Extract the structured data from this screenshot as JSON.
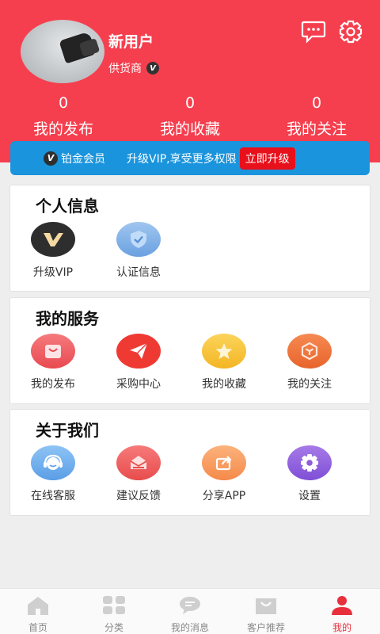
{
  "profile": {
    "name": "新用户",
    "role": "供货商",
    "badge": "V"
  },
  "header_icons": {
    "message": "message-icon",
    "settings": "gear-icon"
  },
  "stats": [
    {
      "count": "0",
      "label": "我的发布"
    },
    {
      "count": "0",
      "label": "我的收藏"
    },
    {
      "count": "0",
      "label": "我的关注"
    }
  ],
  "vip": {
    "badge": "V",
    "level": "铂金会员",
    "desc": "升级VIP,享受更多权限",
    "button": "立即升级"
  },
  "personal": {
    "title": "个人信息",
    "items": [
      {
        "label": "升级VIP",
        "icon": "vip-icon"
      },
      {
        "label": "认证信息",
        "icon": "shield-check-icon"
      }
    ]
  },
  "services": {
    "title": "我的服务",
    "items": [
      {
        "label": "我的发布",
        "icon": "bag-icon"
      },
      {
        "label": "采购中心",
        "icon": "paper-plane-icon"
      },
      {
        "label": "我的收藏",
        "icon": "star-icon"
      },
      {
        "label": "我的关注",
        "icon": "cube-icon"
      }
    ]
  },
  "about": {
    "title": "关于我们",
    "items": [
      {
        "label": "在线客服",
        "icon": "headset-icon"
      },
      {
        "label": "建议反馈",
        "icon": "mail-icon"
      },
      {
        "label": "分享APP",
        "icon": "share-icon"
      },
      {
        "label": "设置",
        "icon": "gear-icon"
      }
    ]
  },
  "tabs": [
    {
      "label": "首页",
      "icon": "home-icon"
    },
    {
      "label": "分类",
      "icon": "grid-icon"
    },
    {
      "label": "我的消息",
      "icon": "chat-icon"
    },
    {
      "label": "客户推荐",
      "icon": "shopping-bag-icon"
    },
    {
      "label": "我的",
      "icon": "user-icon",
      "active": true
    }
  ],
  "colors": {
    "primary": "#f53f4e",
    "vip_bar": "#1a94dc",
    "upgrade": "#e8101b",
    "active_tab": "#e8303c"
  }
}
